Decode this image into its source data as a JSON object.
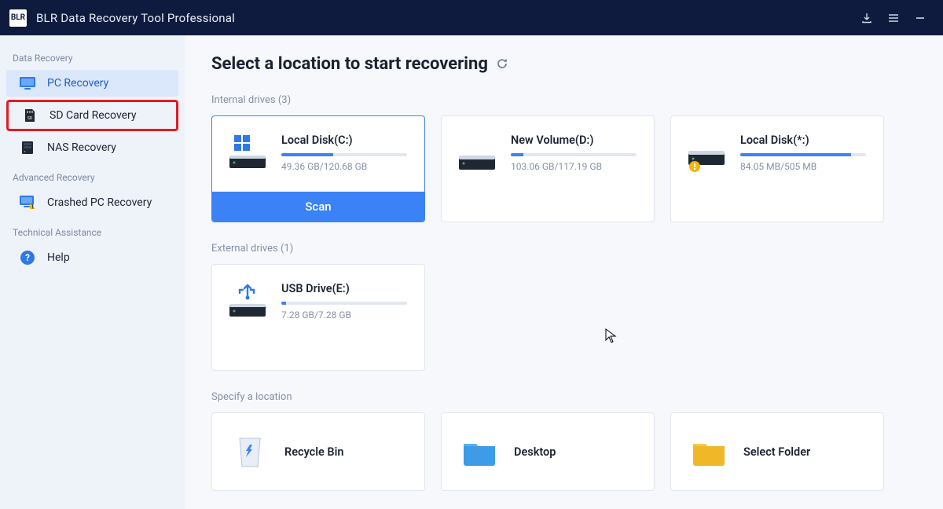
{
  "titlebar": {
    "logo_text": "BLR",
    "app_name": "BLR Data Recovery Tool Professional"
  },
  "sidebar": {
    "groups": [
      {
        "label": "Data Recovery",
        "items": [
          {
            "label": "PC Recovery"
          },
          {
            "label": "SD Card Recovery"
          },
          {
            "label": "NAS Recovery"
          }
        ]
      },
      {
        "label": "Advanced Recovery",
        "items": [
          {
            "label": "Crashed PC Recovery"
          }
        ]
      },
      {
        "label": "Technical Assistance",
        "items": [
          {
            "label": "Help"
          }
        ]
      }
    ]
  },
  "main": {
    "heading": "Select a location to start recovering",
    "internal_label": "Internal drives (3)",
    "external_label": "External drives (1)",
    "specify_label": "Specify a location",
    "scan_label": "Scan",
    "internal_drives": [
      {
        "name": "Local Disk(C:)",
        "size": "49.36 GB/120.68 GB",
        "fill_pct": 41
      },
      {
        "name": "New Volume(D:)",
        "size": "103.06 GB/117.19 GB",
        "fill_pct": 10
      },
      {
        "name": "Local Disk(*:)",
        "size": "84.05 MB/505 MB",
        "fill_pct": 88
      }
    ],
    "external_drives": [
      {
        "name": "USB Drive(E:)",
        "size": "7.28 GB/7.28 GB",
        "fill_pct": 4
      }
    ],
    "locations": [
      {
        "name": "Recycle Bin"
      },
      {
        "name": "Desktop"
      },
      {
        "name": "Select Folder"
      }
    ]
  }
}
